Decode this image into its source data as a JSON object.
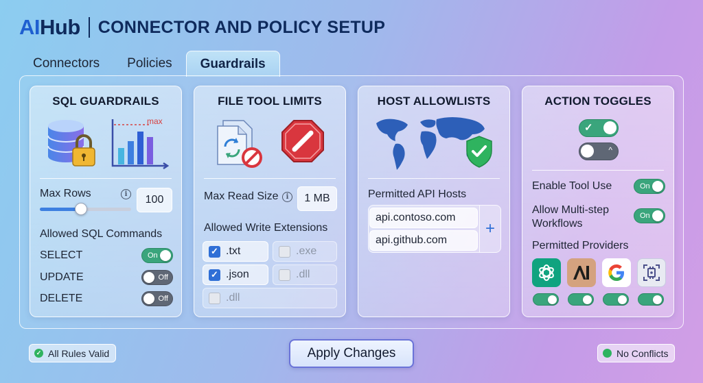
{
  "header": {
    "logo_ai": "AI",
    "logo_hub": "Hub",
    "title": "CONNECTOR AND POLICY SETUP"
  },
  "tabs": [
    {
      "label": "Connectors"
    },
    {
      "label": "Policies"
    },
    {
      "label": "Guardrails",
      "active": true
    }
  ],
  "sql": {
    "title": "SQL GUARDRAILS",
    "max_rows_label": "Max Rows",
    "max_rows_value": "100",
    "slider_fraction": 0.45,
    "allowed_label": "Allowed SQL Commands",
    "commands": [
      {
        "name": "SELECT",
        "state": "On"
      },
      {
        "name": "UPDATE",
        "state": "Off"
      },
      {
        "name": "DELETE",
        "state": "Off"
      }
    ],
    "chart_marker": "max"
  },
  "file": {
    "title": "FILE TOOL LIMITS",
    "max_read_label": "Max Read Size",
    "max_read_value": "1 MB",
    "write_label": "Allowed Write Extensions",
    "extensions": [
      {
        "ext": ".txt",
        "checked": true
      },
      {
        "ext": ".exe",
        "checked": false
      },
      {
        "ext": ".json",
        "checked": true
      },
      {
        "ext": ".dll",
        "checked": false
      },
      {
        "ext": ".dll",
        "checked": false
      }
    ]
  },
  "hosts": {
    "title": "HOST ALLOWLISTS",
    "permitted_label": "Permitted API Hosts",
    "list": [
      "api.contoso.com",
      "api.github.com"
    ],
    "add_symbol": "+"
  },
  "actions": {
    "title": "ACTION TOGGLES",
    "enable_tool_label": "Enable Tool Use",
    "enable_tool_state": "On",
    "multistep_label_1": "Allow Multi-step",
    "multistep_label_2": "Workflows",
    "multistep_state": "On",
    "providers_label": "Permitted Providers",
    "providers": [
      {
        "icon": "openai-icon",
        "color": "#10a37f",
        "enabled": true
      },
      {
        "icon": "anthropic-icon",
        "color": "#d4a27f",
        "enabled": true
      },
      {
        "icon": "google-icon",
        "color": "#ffffff",
        "enabled": true
      },
      {
        "icon": "circuit-provider-icon",
        "color": "#e8eaf2",
        "enabled": true
      }
    ]
  },
  "footer": {
    "valid_label": "All Rules Valid",
    "apply_label": "Apply Changes",
    "conflicts_label": "No Conflicts"
  },
  "colors": {
    "accent": "#2f6fd6",
    "toggle_on": "#3aa57c",
    "toggle_off": "#5f6775",
    "status_ok": "#2fb35f"
  }
}
